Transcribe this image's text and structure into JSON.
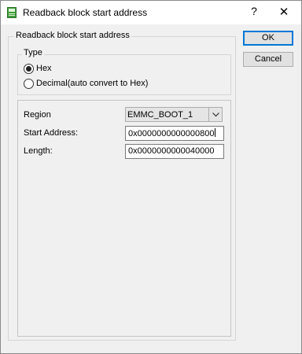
{
  "window": {
    "title": "Readback block start address",
    "help_glyph": "?",
    "close_glyph": "✕",
    "icon": "app-icon"
  },
  "dialog": {
    "group_title": "Readback block start address",
    "type": {
      "title": "Type",
      "options": [
        {
          "label": "Hex",
          "selected": true
        },
        {
          "label": "Decimal(auto convert to Hex)",
          "selected": false
        }
      ]
    },
    "fields": {
      "region_label": "Region",
      "region_value": "EMMC_BOOT_1",
      "start_address_label": "Start Address:",
      "start_address_value": "0x0000000000000800",
      "length_label": "Length:",
      "length_value": "0x0000000000040000"
    }
  },
  "buttons": {
    "ok": "OK",
    "cancel": "Cancel"
  }
}
